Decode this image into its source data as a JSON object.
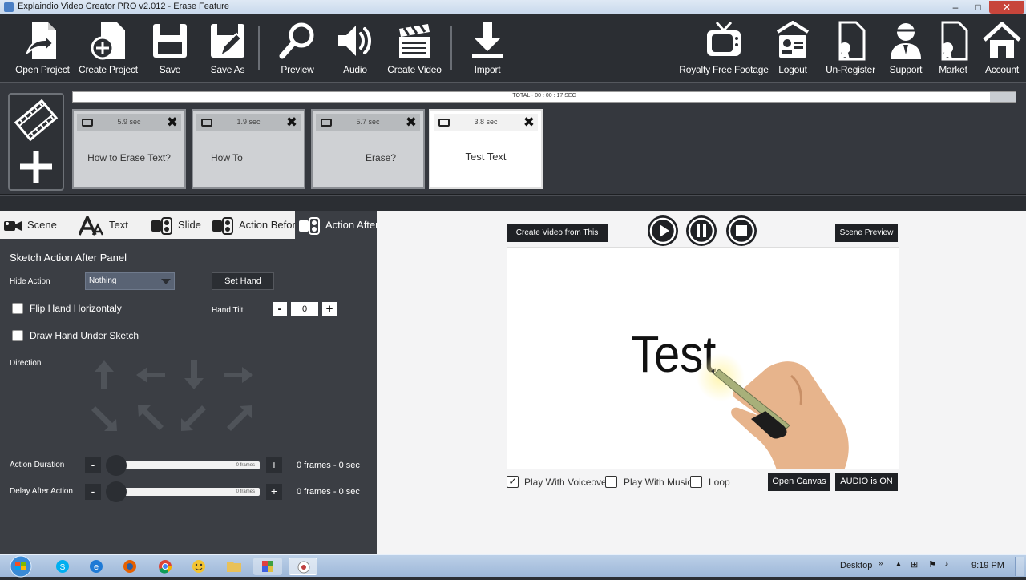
{
  "window": {
    "title": "Explaindio Video Creator PRO v2.012 - Erase Feature",
    "minimize": "–",
    "maximize": "□",
    "close": "✕"
  },
  "toolbar": {
    "open_project": "Open Project",
    "create_project": "Create Project",
    "save": "Save",
    "save_as": "Save As",
    "preview": "Preview",
    "audio": "Audio",
    "create_video": "Create Video",
    "import": "Import",
    "royalty_free_footage": "Royalty Free Footage",
    "logout": "Logout",
    "un_register": "Un-Register",
    "support": "Support",
    "market": "Market",
    "account": "Account"
  },
  "timeline": {
    "total": "TOTAL - 00 : 00 : 17 SEC",
    "scenes": [
      {
        "duration": "5.9 sec",
        "name": "How to Erase Text?"
      },
      {
        "duration": "1.9 sec",
        "name": "How To"
      },
      {
        "duration": "5.7 sec",
        "name": "Erase?"
      },
      {
        "duration": "3.8 sec",
        "name": "Test Text"
      }
    ]
  },
  "tabs": {
    "scene": "Scene",
    "text": "Text",
    "slide": "Slide",
    "action_before": "Action Before",
    "action_after": "Action After"
  },
  "panel": {
    "title": "Sketch Action After Panel",
    "hide_action_label": "Hide Action",
    "hide_action_value": "Nothing",
    "set_hand": "Set Hand",
    "flip_hand": "Flip Hand Horizontaly",
    "hand_tilt_label": "Hand Tilt",
    "hand_tilt_value": "0",
    "draw_hand_under": "Draw Hand Under Sketch",
    "direction_label": "Direction",
    "action_duration_label": "Action Duration",
    "action_duration_value": "0 frames - 0 sec",
    "delay_after_label": "Delay After Action",
    "delay_after_value": "0 frames - 0 sec",
    "slider_inner_label": "0 frames",
    "minus": "-",
    "plus": "+"
  },
  "preview": {
    "create_from_scene": "Create Video from This Scene",
    "scene_preview": "Scene Preview",
    "canvas_text": "Test",
    "play_with_voiceover": "Play With Voiceover",
    "play_with_music": "Play With Music",
    "loop": "Loop",
    "open_canvas": "Open Canvas",
    "audio_on": "AUDIO is ON",
    "voiceover_checked": "✓"
  },
  "taskbar": {
    "desktop": "Desktop",
    "clock": "9:19 PM"
  },
  "colors": {
    "toolbar_bg": "#2b2e33",
    "panel_bg": "#3b3e44",
    "preview_bg": "#f4f4f5",
    "button_dark": "#1f2125"
  }
}
